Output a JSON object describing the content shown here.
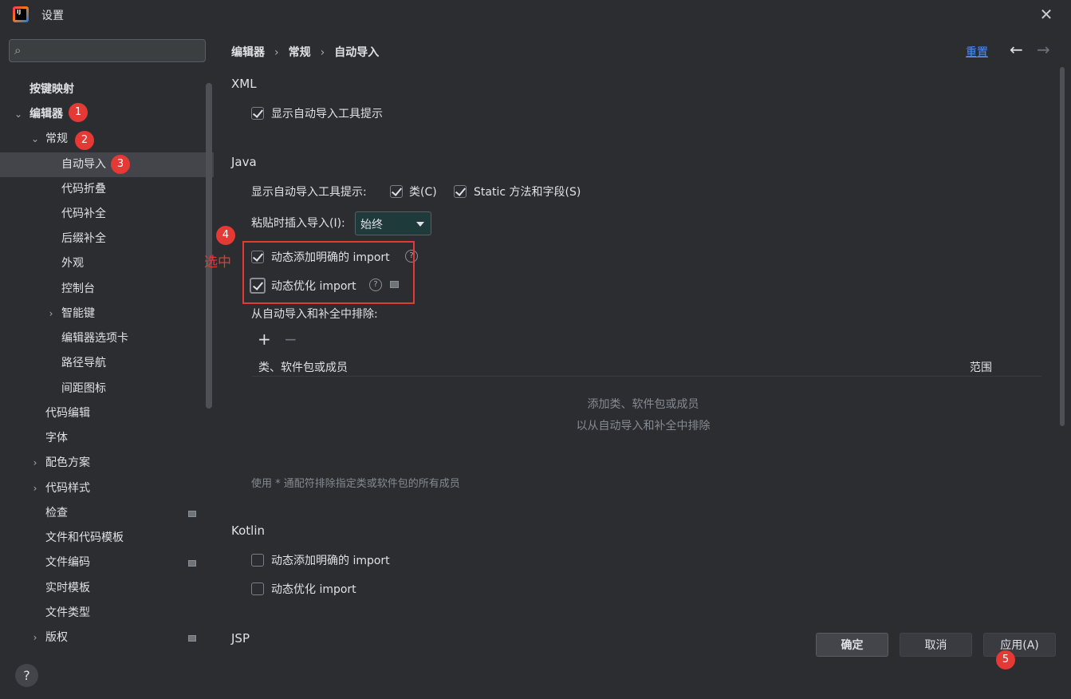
{
  "window": {
    "title": "设置",
    "logo_text": "IJ",
    "close_glyph": "✕"
  },
  "search": {
    "placeholder": "",
    "value": "",
    "icon": "search-icon"
  },
  "sidebar": {
    "items": [
      {
        "label": "按键映射"
      },
      {
        "label": "编辑器"
      },
      {
        "label": "常规"
      },
      {
        "label": "自动导入"
      },
      {
        "label": "代码折叠"
      },
      {
        "label": "代码补全"
      },
      {
        "label": "后缀补全"
      },
      {
        "label": "外观"
      },
      {
        "label": "控制台"
      },
      {
        "label": "智能键"
      },
      {
        "label": "编辑器选项卡"
      },
      {
        "label": "路径导航"
      },
      {
        "label": "间距图标"
      },
      {
        "label": "代码编辑"
      },
      {
        "label": "字体"
      },
      {
        "label": "配色方案"
      },
      {
        "label": "代码样式"
      },
      {
        "label": "检查"
      },
      {
        "label": "文件和代码模板"
      },
      {
        "label": "文件编码"
      },
      {
        "label": "实时模板"
      },
      {
        "label": "文件类型"
      },
      {
        "label": "版权"
      }
    ]
  },
  "breadcrumb": {
    "items": [
      "编辑器",
      "常规",
      "自动导入"
    ],
    "separator": "›"
  },
  "header": {
    "reset_label": "重置",
    "back_glyph": "←",
    "forward_glyph": "→"
  },
  "xml": {
    "title": "XML",
    "show_popup_label": "显示自动导入工具提示",
    "show_popup_checked": true
  },
  "java": {
    "title": "Java",
    "show_popup_label": "显示自动导入工具提示:",
    "class_label": "类(C)",
    "class_checked": true,
    "static_label": "Static 方法和字段(S)",
    "static_checked": true,
    "paste_label": "粘贴时插入导入(I):",
    "paste_value": "始终",
    "add_unambiguous_label": "动态添加明确的 import",
    "add_unambiguous_checked": true,
    "optimize_label": "动态优化 import",
    "optimize_checked": true,
    "exclude_label": "从自动导入和补全中排除:",
    "add_glyph": "+",
    "remove_glyph": "−",
    "col_class": "类、软件包或成员",
    "col_scope": "范围",
    "empty_line1": "添加类、软件包或成员",
    "empty_line2": "以从自动导入和补全中排除",
    "hint": "使用 * 通配符排除指定类或软件包的所有成员"
  },
  "kotlin": {
    "title": "Kotlin",
    "add_unambiguous_label": "动态添加明确的 import",
    "add_unambiguous_checked": false,
    "optimize_label": "动态优化 import",
    "optimize_checked": false
  },
  "jsp": {
    "title": "JSP"
  },
  "annotations": {
    "badge1": "1",
    "badge2": "2",
    "badge3": "3",
    "badge4": "4",
    "badge5": "5",
    "select_text": "选中",
    "color": "#e53935"
  },
  "footer": {
    "help_glyph": "?",
    "ok_label": "确定",
    "cancel_label": "取消",
    "apply_label": "应用(A)"
  }
}
